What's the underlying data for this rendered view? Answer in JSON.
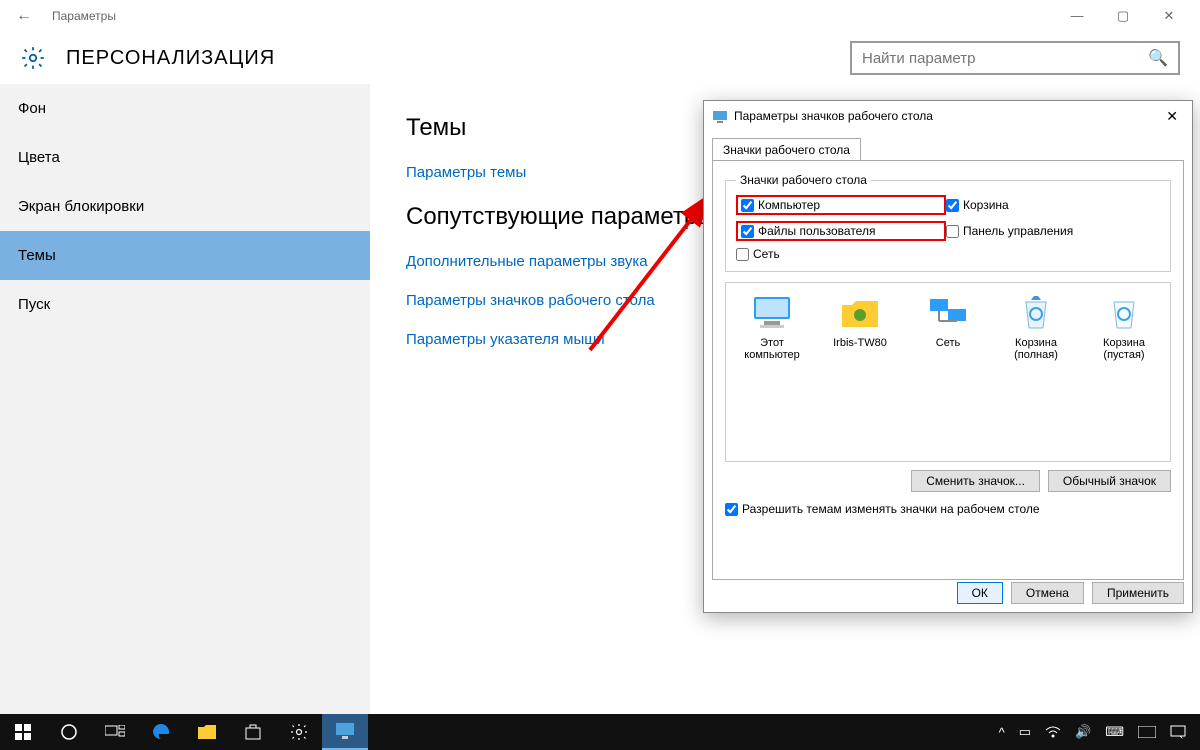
{
  "titlebar": {
    "title": "Параметры"
  },
  "header": {
    "title": "ПЕРСОНАЛИЗАЦИЯ",
    "search_placeholder": "Найти параметр"
  },
  "sidebar": {
    "items": [
      {
        "label": "Фон"
      },
      {
        "label": "Цвета"
      },
      {
        "label": "Экран блокировки"
      },
      {
        "label": "Темы",
        "selected": true
      },
      {
        "label": "Пуск"
      }
    ]
  },
  "content": {
    "h1": "Темы",
    "link1": "Параметры темы",
    "h2": "Сопутствующие параметры",
    "link2": "Дополнительные параметры звука",
    "link3": "Параметры значков рабочего стола",
    "link4": "Параметры указателя мыши"
  },
  "dialog": {
    "title": "Параметры значков рабочего стола",
    "tab": "Значки рабочего стола",
    "legend": "Значки рабочего стола",
    "checks": {
      "computer": "Компьютер",
      "recycle": "Корзина",
      "userfiles": "Файлы пользователя",
      "control": "Панель управления",
      "network": "Сеть"
    },
    "icons": [
      {
        "label": "Этот компьютер"
      },
      {
        "label": "Irbis-TW80"
      },
      {
        "label": "Сеть"
      },
      {
        "label": "Корзина (полная)"
      },
      {
        "label": "Корзина (пустая)"
      }
    ],
    "change_icon": "Сменить значок...",
    "default_icon": "Обычный значок",
    "allow_themes": "Разрешить темам изменять значки на рабочем столе",
    "ok": "ОК",
    "cancel": "Отмена",
    "apply": "Применить"
  },
  "taskbar": {
    "time": "",
    "date": ""
  }
}
